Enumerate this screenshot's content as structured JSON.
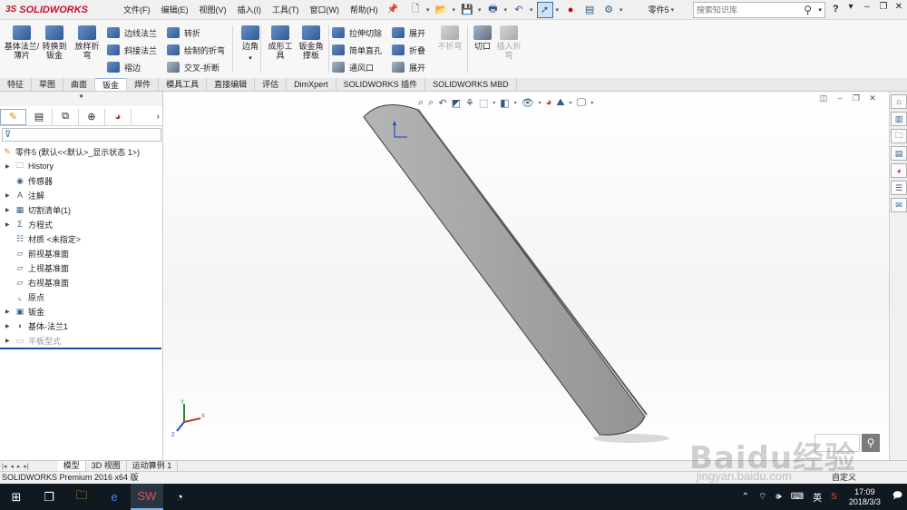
{
  "app": {
    "brand": "SOLIDWORKS",
    "brand_prefix": "3S",
    "document_name": "零件5"
  },
  "menu": [
    "文件(F)",
    "编辑(E)",
    "视图(V)",
    "插入(I)",
    "工具(T)",
    "窗口(W)",
    "帮助(H)"
  ],
  "search": {
    "placeholder": "搜索知识库"
  },
  "ribbon": {
    "big_buttons": [
      {
        "label": "基体法兰/薄片",
        "line2": "兰/薄片"
      },
      {
        "label": "转换到",
        "line2": "钣金"
      },
      {
        "label": "放样折",
        "line2": "弯"
      }
    ],
    "flange_group": [
      "边线法兰",
      "斜接法兰",
      "褶边"
    ],
    "bend_group": [
      "转折",
      "绘制的折弯",
      "交叉-折断"
    ],
    "corner": "边角",
    "forming": {
      "line1": "成形工",
      "line2": "具"
    },
    "gusset": {
      "line1": "钣金角",
      "line2": "撑板"
    },
    "cut_group": [
      "拉伸切除",
      "简单直孔",
      "通风口"
    ],
    "unfold_group": [
      "展开",
      "折叠",
      "展开"
    ],
    "no_bend": "不折弯",
    "rip": "切口",
    "insert_bends": {
      "line1": "插入折",
      "line2": "弯"
    }
  },
  "tabs": [
    "特征",
    "草图",
    "曲面",
    "钣金",
    "焊件",
    "模具工具",
    "直接编辑",
    "评估",
    "DimXpert",
    "SOLIDWORKS 插件",
    "SOLIDWORKS MBD"
  ],
  "active_tab": "钣金",
  "tree": {
    "root": "零件5 (默认<<默认>_显示状态 1>)",
    "items": [
      {
        "label": "History",
        "expandable": true,
        "icon": "folder-icon"
      },
      {
        "label": "传感器",
        "expandable": false,
        "icon": "sensor-icon"
      },
      {
        "label": "注解",
        "expandable": true,
        "icon": "annotation-icon"
      },
      {
        "label": "切割清单(1)",
        "expandable": true,
        "icon": "cut-list-icon"
      },
      {
        "label": "方程式",
        "expandable": true,
        "icon": "equation-icon"
      },
      {
        "label": "材质 <未指定>",
        "expandable": false,
        "icon": "material-icon"
      },
      {
        "label": "前视基准面",
        "expandable": false,
        "icon": "plane-icon"
      },
      {
        "label": "上视基准面",
        "expandable": false,
        "icon": "plane-icon"
      },
      {
        "label": "右视基准面",
        "expandable": false,
        "icon": "plane-icon"
      },
      {
        "label": "原点",
        "expandable": false,
        "icon": "origin-icon"
      },
      {
        "label": "钣金",
        "expandable": true,
        "icon": "sheetmetal-icon"
      },
      {
        "label": "基体-法兰1",
        "expandable": true,
        "icon": "base-flange-icon"
      },
      {
        "label": "平板型式",
        "expandable": true,
        "icon": "flat-pattern-icon",
        "muted": true
      }
    ]
  },
  "bottom_tabs": [
    "模型",
    "3D 视图",
    "运动算例 1"
  ],
  "status": {
    "left": "SOLIDWORKS Premium 2016 x64 版",
    "right": "自定义"
  },
  "triad": {
    "x": "X",
    "y": "Y",
    "z": "Z"
  },
  "taskbar": {
    "ime": "英",
    "time": "17:09",
    "date": "2018/3/3"
  },
  "watermark": {
    "text": "Baidu经验",
    "url": "jingyan.baidu.com"
  },
  "colors": {
    "accent": "#c8102e",
    "selection": "#cfe1f5",
    "part_gray": "#a3a3a3"
  }
}
